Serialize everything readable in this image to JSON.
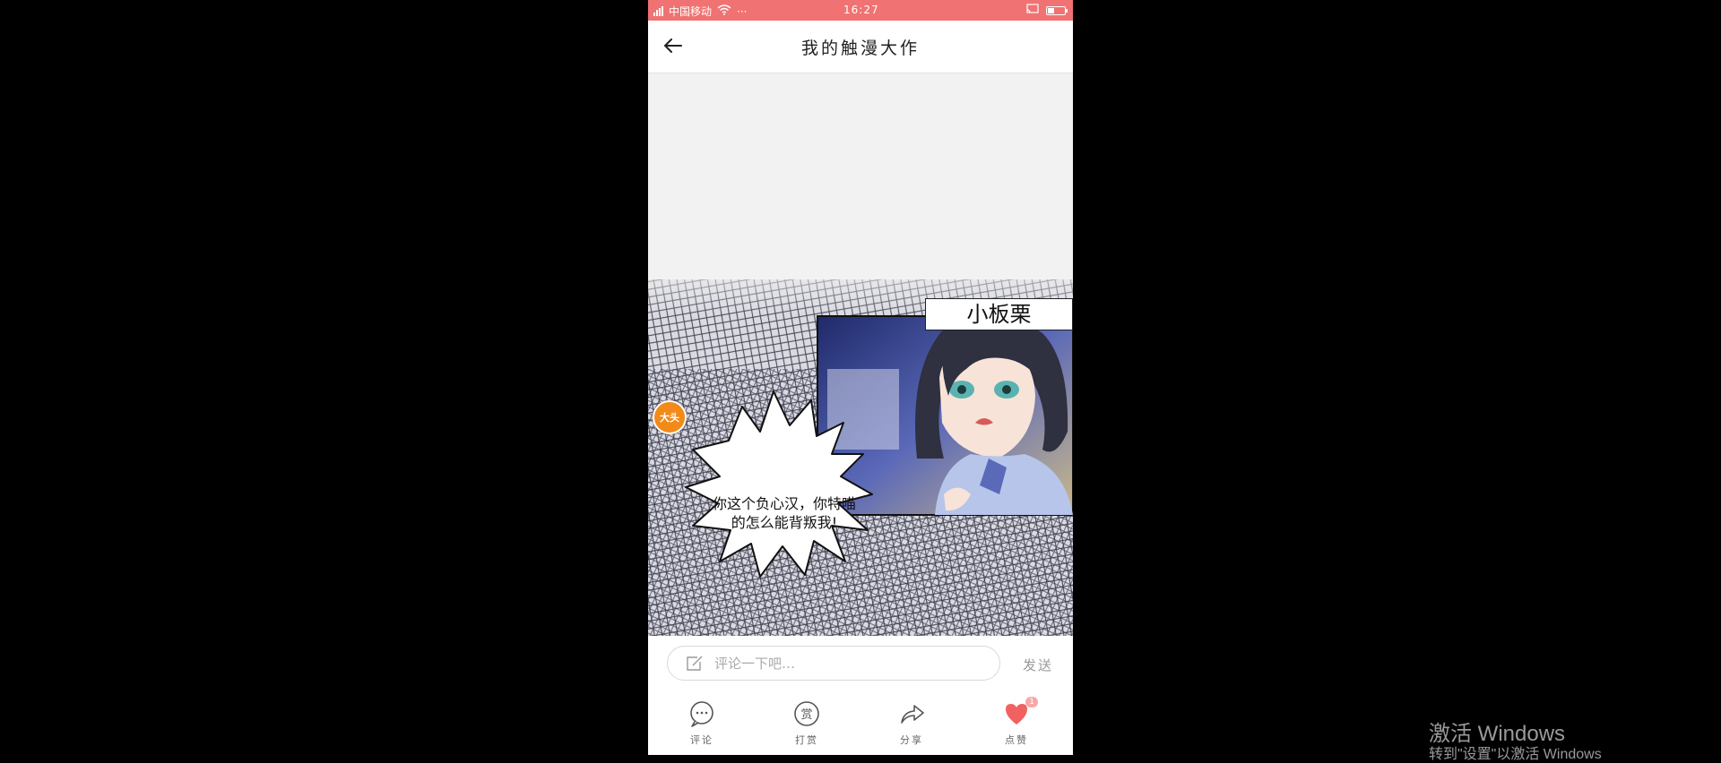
{
  "status_bar": {
    "carrier": "中国移动",
    "dots": "···",
    "time": "16:27"
  },
  "header": {
    "title": "我的触漫大作"
  },
  "comic": {
    "character_name": "小板栗",
    "speech": "你这个负心汉，你特喵的怎么能背叛我!",
    "sticker": "大头"
  },
  "comment": {
    "placeholder": "评论一下吧…",
    "send_label": "发送"
  },
  "actions": {
    "comment_label": "评论",
    "reward_label": "打赏",
    "share_label": "分享",
    "like_label": "点赞",
    "like_count": "1",
    "reward_icon_char": "赏"
  },
  "watermark": {
    "line1": "激活 Windows",
    "line2": "转到\"设置\"以激活 Windows"
  },
  "colors": {
    "status_bar": "#f07272",
    "like_heart": "#f06262"
  }
}
